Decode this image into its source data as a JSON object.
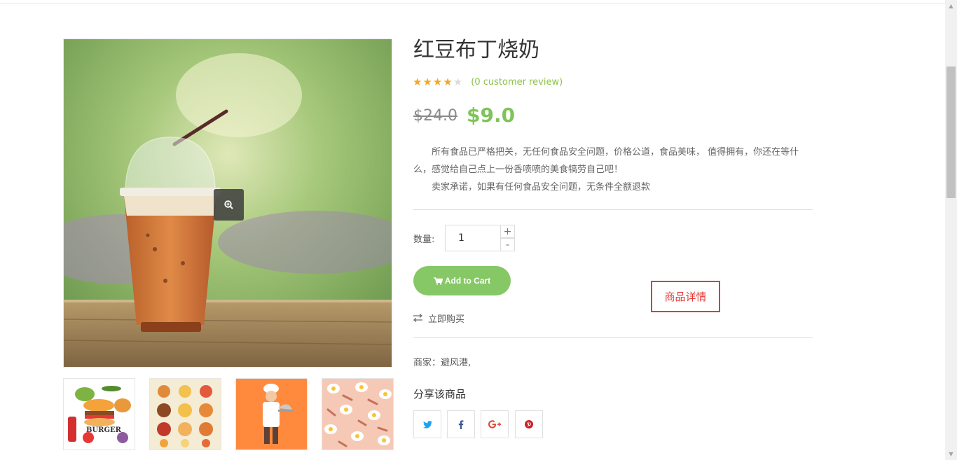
{
  "product": {
    "title": "红豆布丁烧奶",
    "rating": 4,
    "max_rating": 5,
    "review_text": "(0 customer review)",
    "old_price": "$24.0",
    "new_price": "$9.0",
    "description": [
      "所有食品已严格把关，无任何食品安全问题，价格公道，食品美味， 值得拥有，你还在等什么，感觉给自己点上一份香喷喷的美食犒劳自己吧！",
      "卖家承诺，如果有任何食品安全问题，无条件全额退款"
    ]
  },
  "quantity": {
    "label": "数量:",
    "value": "1",
    "plus": "+",
    "minus": "-"
  },
  "actions": {
    "add_to_cart": "Add to Cart",
    "buy_now": "立即购买",
    "detail": "商品详情"
  },
  "seller": "商家：避风港,",
  "share": {
    "title": "分享该商品",
    "items": [
      "twitter-icon",
      "facebook-icon",
      "google-plus-icon",
      "pinterest-icon"
    ]
  },
  "colors": {
    "accent_green": "#86c866",
    "price_green": "#7fc45a",
    "star": "#f5a623",
    "review_green": "#8bc34a",
    "detail_red": "#e53935",
    "twitter": "#1da1f2",
    "facebook": "#3b5998",
    "google_plus": "#dd4b39",
    "pinterest": "#cb2027"
  },
  "thumbnails": [
    "burger-ingredients-image",
    "dishes-plates-image",
    "chef-image",
    "fried-eggs-pattern-image"
  ]
}
